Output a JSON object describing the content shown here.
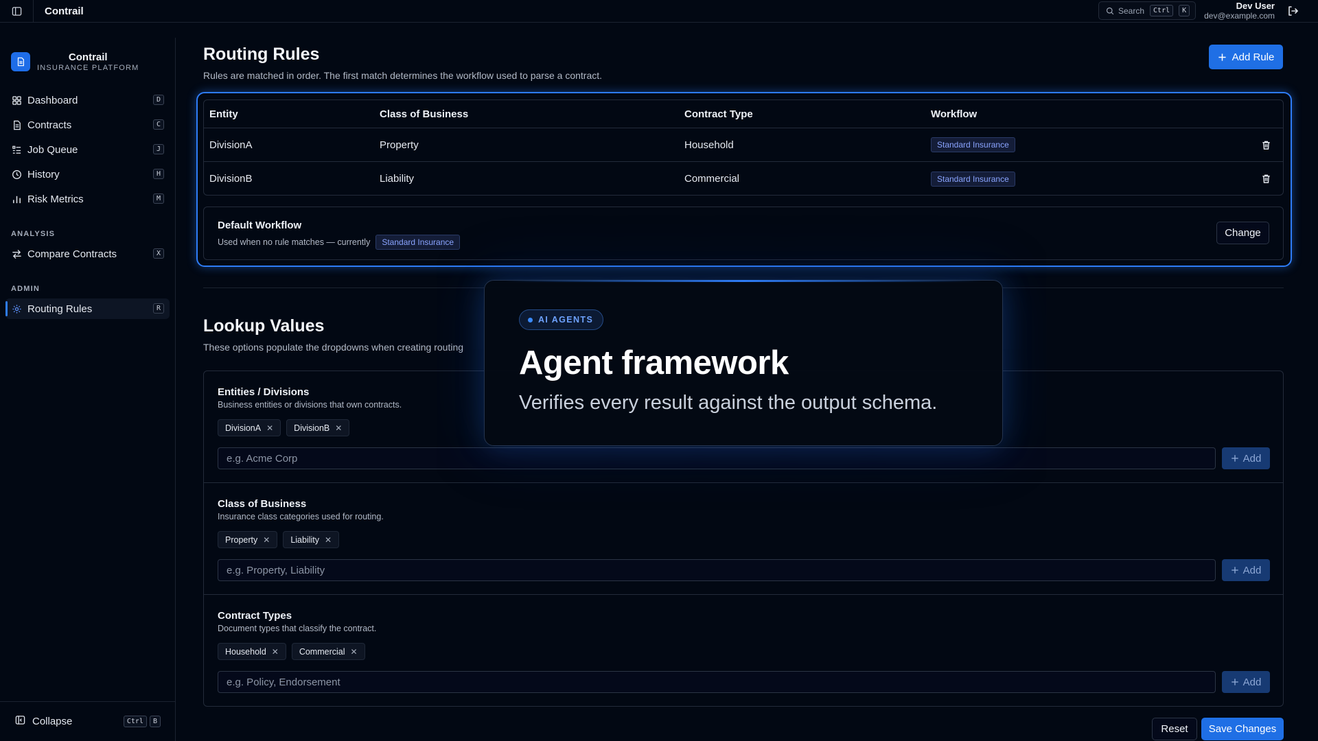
{
  "topbar": {
    "app_title": "Contrail",
    "search_label": "Search",
    "search_keys": [
      "Ctrl",
      "K"
    ],
    "user_name": "Dev User",
    "user_email": "dev@example.com"
  },
  "sidebar": {
    "brand_name": "Contrail",
    "brand_sub": "INSURANCE PLATFORM",
    "main_items": [
      {
        "label": "Dashboard",
        "key": "D",
        "icon": "dashboard-icon"
      },
      {
        "label": "Contracts",
        "key": "C",
        "icon": "contracts-icon"
      },
      {
        "label": "Job Queue",
        "key": "J",
        "icon": "job-queue-icon"
      },
      {
        "label": "History",
        "key": "H",
        "icon": "history-icon"
      },
      {
        "label": "Risk Metrics",
        "key": "M",
        "icon": "risk-metrics-icon"
      }
    ],
    "analysis_label": "ANALYSIS",
    "analysis_items": [
      {
        "label": "Compare Contracts",
        "key": "X",
        "icon": "compare-icon"
      }
    ],
    "admin_label": "ADMIN",
    "admin_items": [
      {
        "label": "Routing Rules",
        "key": "R",
        "icon": "gear-icon",
        "active": true
      }
    ],
    "collapse_label": "Collapse",
    "collapse_keys": [
      "Ctrl",
      "B"
    ]
  },
  "routing": {
    "title": "Routing Rules",
    "subtitle": "Rules are matched in order. The first match determines the workflow used to parse a contract.",
    "add_rule_label": "Add Rule",
    "columns": [
      "Entity",
      "Class of Business",
      "Contract Type",
      "Workflow"
    ],
    "rows": [
      {
        "entity": "DivisionA",
        "class": "Property",
        "type": "Household",
        "workflow": "Standard Insurance"
      },
      {
        "entity": "DivisionB",
        "class": "Liability",
        "type": "Commercial",
        "workflow": "Standard Insurance"
      }
    ],
    "default_title": "Default Workflow",
    "default_desc": "Used when no rule matches — currently",
    "default_workflow": "Standard Insurance",
    "change_label": "Change"
  },
  "lookup": {
    "title": "Lookup Values",
    "subtitle": "These options populate the dropdowns when creating routing",
    "sections": [
      {
        "title": "Entities / Divisions",
        "desc": "Business entities or divisions that own contracts.",
        "chips": [
          "DivisionA",
          "DivisionB"
        ],
        "placeholder": "e.g. Acme Corp",
        "add_label": "Add"
      },
      {
        "title": "Class of Business",
        "desc": "Insurance class categories used for routing.",
        "chips": [
          "Property",
          "Liability"
        ],
        "placeholder": "e.g. Property, Liability",
        "add_label": "Add"
      },
      {
        "title": "Contract Types",
        "desc": "Document types that classify the contract.",
        "chips": [
          "Household",
          "Commercial"
        ],
        "placeholder": "e.g. Policy, Endorsement",
        "add_label": "Add"
      }
    ],
    "reset_label": "Reset",
    "save_label": "Save Changes"
  },
  "overlay": {
    "pill": "AI AGENTS",
    "title": "Agent framework",
    "text": "Verifies every result against the output schema."
  },
  "colors": {
    "accent": "#1f6fe5",
    "background": "#020813",
    "badge_text": "#8aa4ff"
  }
}
